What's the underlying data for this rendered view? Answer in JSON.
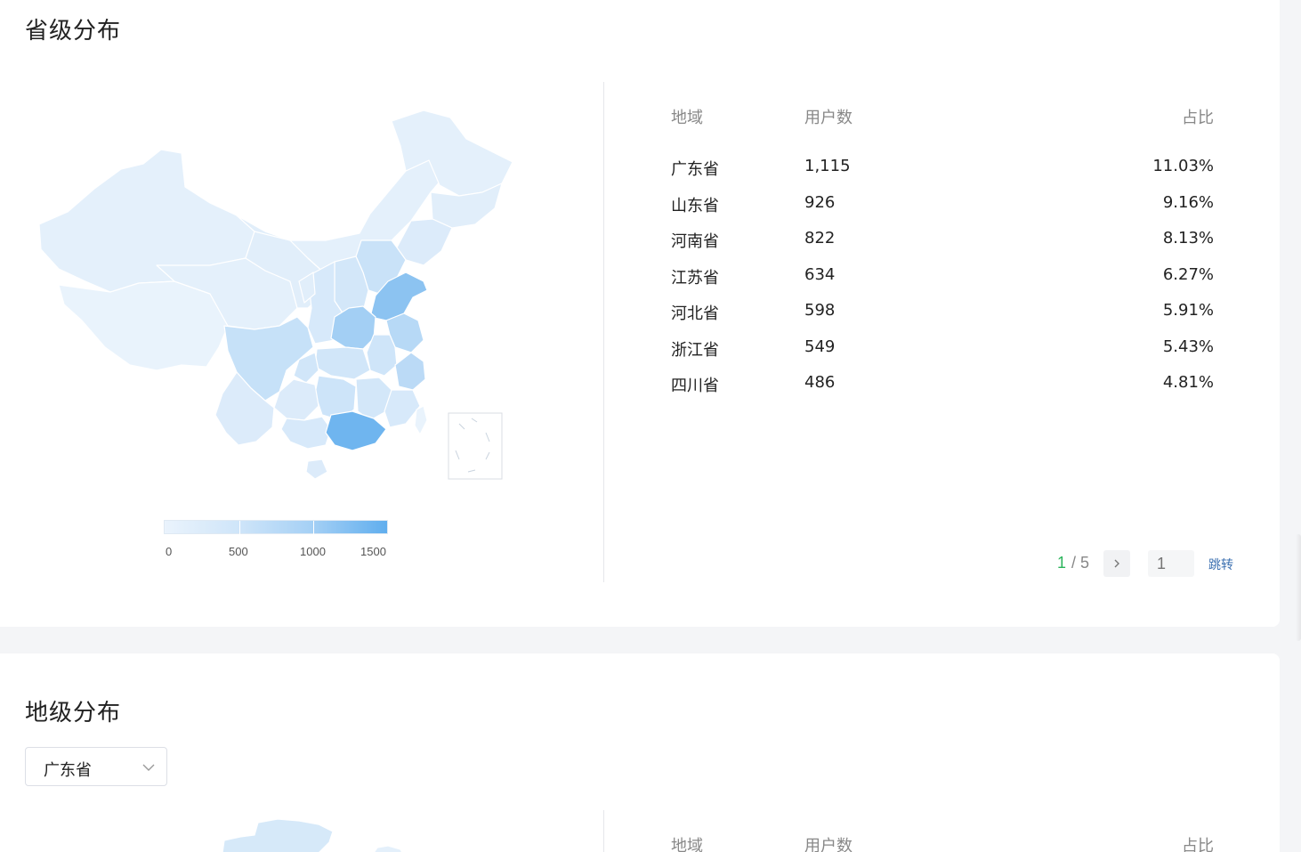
{
  "province_section": {
    "title": "省级分布",
    "legend": {
      "labels": [
        "0",
        "500",
        "1000",
        "1500"
      ]
    },
    "table": {
      "headers": {
        "region": "地域",
        "users": "用户数",
        "ratio": "占比"
      },
      "rows": [
        {
          "region": "广东省",
          "users": "1,115",
          "ratio": "11.03%"
        },
        {
          "region": "山东省",
          "users": "926",
          "ratio": "9.16%"
        },
        {
          "region": "河南省",
          "users": "822",
          "ratio": "8.13%"
        },
        {
          "region": "江苏省",
          "users": "634",
          "ratio": "6.27%"
        },
        {
          "region": "河北省",
          "users": "598",
          "ratio": "5.91%"
        },
        {
          "region": "浙江省",
          "users": "549",
          "ratio": "5.43%"
        },
        {
          "region": "四川省",
          "users": "486",
          "ratio": "4.81%"
        }
      ]
    },
    "pager": {
      "current": "1",
      "separator": "/ 5",
      "next_icon": "chevron-right-icon",
      "input_placeholder": "1",
      "jump_label": "跳转"
    }
  },
  "city_section": {
    "title": "地级分布",
    "select_value": "广东省",
    "table": {
      "headers": {
        "region": "地域",
        "users": "用户数",
        "ratio": "占比"
      }
    }
  },
  "colors": {
    "pager_current": "#2bb45b",
    "jump_link": "#3a6fb0",
    "map_low": "#eaf3fc",
    "map_high": "#60aeee"
  }
}
